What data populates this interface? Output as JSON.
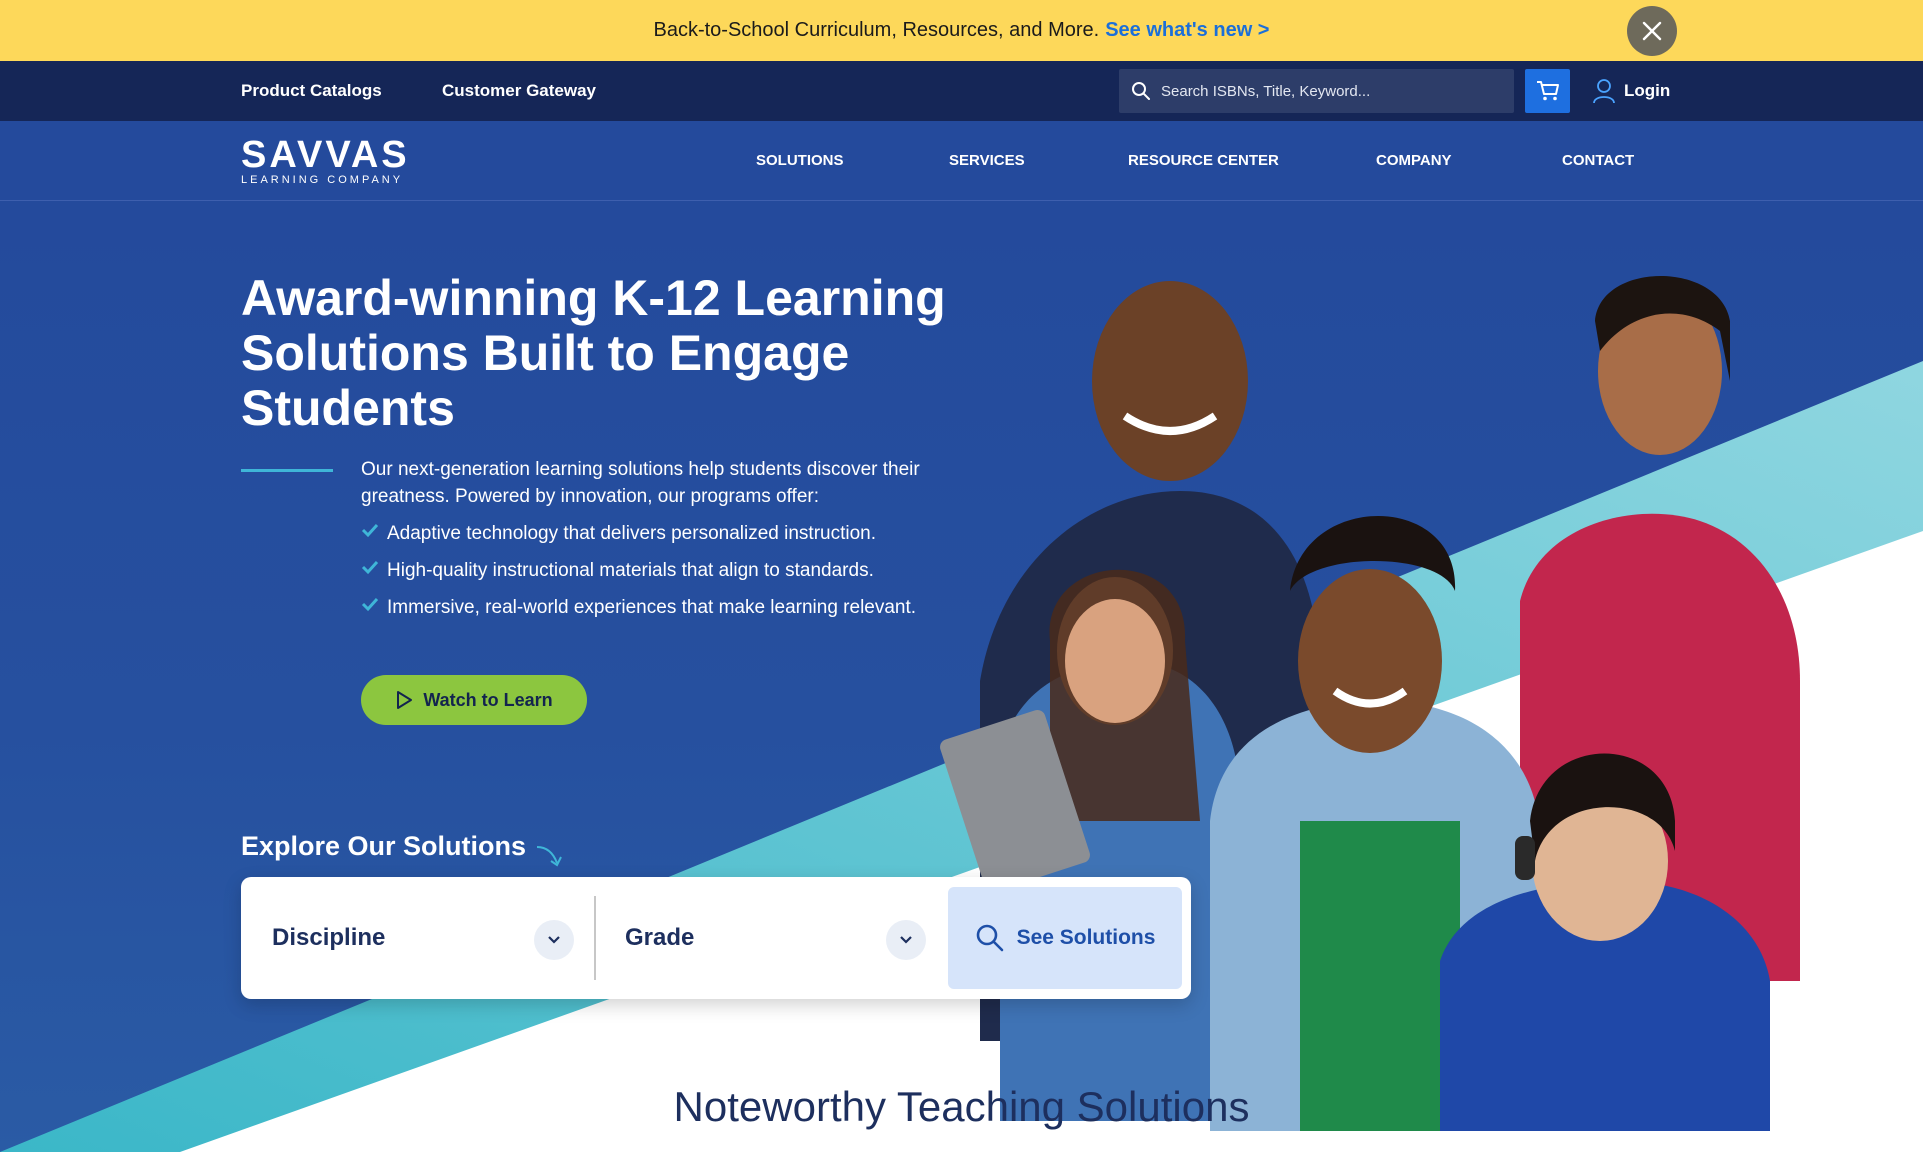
{
  "announcement": {
    "text": "Back-to-School Curriculum, Resources, and More.",
    "link": "See what's new >"
  },
  "utility": {
    "product_catalogs": "Product Catalogs",
    "customer_gateway": "Customer Gateway",
    "search_placeholder": "Search ISBNs, Title, Keyword...",
    "login": "Login"
  },
  "brand": {
    "name": "SAVVAS",
    "tagline": "LEARNING COMPANY"
  },
  "nav": {
    "items": [
      "SOLUTIONS",
      "SERVICES",
      "RESOURCE CENTER",
      "COMPANY",
      "CONTACT"
    ]
  },
  "hero": {
    "headline": "Award-winning K-12 Learning Solutions Built to Engage Students",
    "intro": "Our next-generation learning solutions help students discover their greatness. Powered by innovation, our programs offer:",
    "bullets": [
      "Adaptive technology that delivers personalized instruction.",
      "High-quality instructional materials that align to standards.",
      "Immersive, real-world experiences that make learning relevant."
    ],
    "watch_label": "Watch to Learn"
  },
  "explore": {
    "title": "Explore Our Solutions",
    "discipline": "Discipline",
    "grade": "Grade",
    "see_label": "See Solutions"
  },
  "section": {
    "title": "Noteworthy Teaching Solutions"
  },
  "colors": {
    "announcement_bg": "#fdd85a",
    "utility_bg": "#152657",
    "nav_bg": "#244a9c",
    "accent_teal": "#7fd0db",
    "cta_green": "#8cc63f",
    "link_blue": "#1b6fd9"
  }
}
